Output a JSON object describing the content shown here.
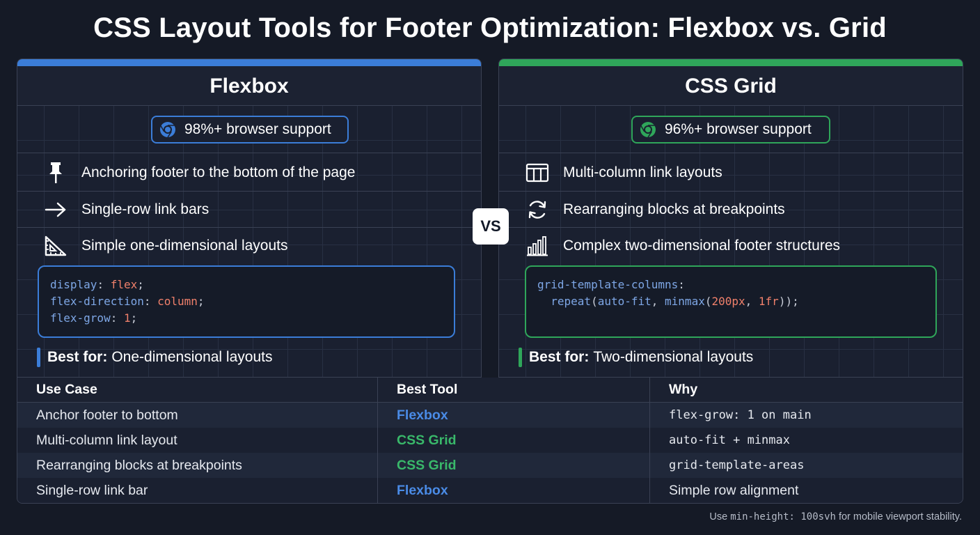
{
  "title": "CSS Layout Tools for Footer Optimization: Flexbox vs. Grid",
  "colors": {
    "flexbox_accent": "#3b7dd8",
    "grid_accent": "#2fa65a",
    "background": "#151a26"
  },
  "flexbox": {
    "heading": "Flexbox",
    "support": "98%+ browser support",
    "features": [
      {
        "icon": "pin-icon",
        "text": "Anchoring footer to the bottom of the page"
      },
      {
        "icon": "arrow-right-icon",
        "text": "Single-row link bars"
      },
      {
        "icon": "ruler-triangle-icon",
        "text": "Simple one-dimensional layouts"
      }
    ],
    "code": [
      {
        "prop": "display",
        "value": "flex"
      },
      {
        "prop": "flex-direction",
        "value": "column"
      },
      {
        "prop": "flex-grow",
        "value": "1"
      }
    ],
    "best_label": "Best for:",
    "best_text": "One-dimensional layouts"
  },
  "vs_label": "VS",
  "grid": {
    "heading": "CSS Grid",
    "support": "96%+ browser support",
    "features": [
      {
        "icon": "columns-icon",
        "text": "Multi-column link layouts"
      },
      {
        "icon": "refresh-icon",
        "text": "Rearranging blocks at breakpoints"
      },
      {
        "icon": "bar-chart-icon",
        "text": "Complex two-dimensional footer structures"
      }
    ],
    "code": {
      "prop": "grid-template-columns",
      "fn1": "repeat",
      "arg1": "auto-fit",
      "fn2": "minmax",
      "arg2": "200px",
      "arg3": "1fr"
    },
    "best_label": "Best for:",
    "best_text": "Two-dimensional layouts"
  },
  "table": {
    "headers": [
      "Use Case",
      "Best Tool",
      "Why"
    ],
    "rows": [
      {
        "use_case": "Anchor footer to bottom",
        "tool": "Flexbox",
        "why": "flex-grow: 1 on main"
      },
      {
        "use_case": "Multi-column link layout",
        "tool": "CSS Grid",
        "why": "auto-fit + minmax"
      },
      {
        "use_case": "Rearranging blocks at breakpoints",
        "tool": "CSS Grid",
        "why": "grid-template-areas"
      },
      {
        "use_case": "Single-row link bar",
        "tool": "Flexbox",
        "why": "Simple row alignment"
      }
    ]
  },
  "footnote": {
    "prefix": "Use",
    "code": "min-height: 100svh",
    "suffix": "for mobile viewport stability."
  }
}
